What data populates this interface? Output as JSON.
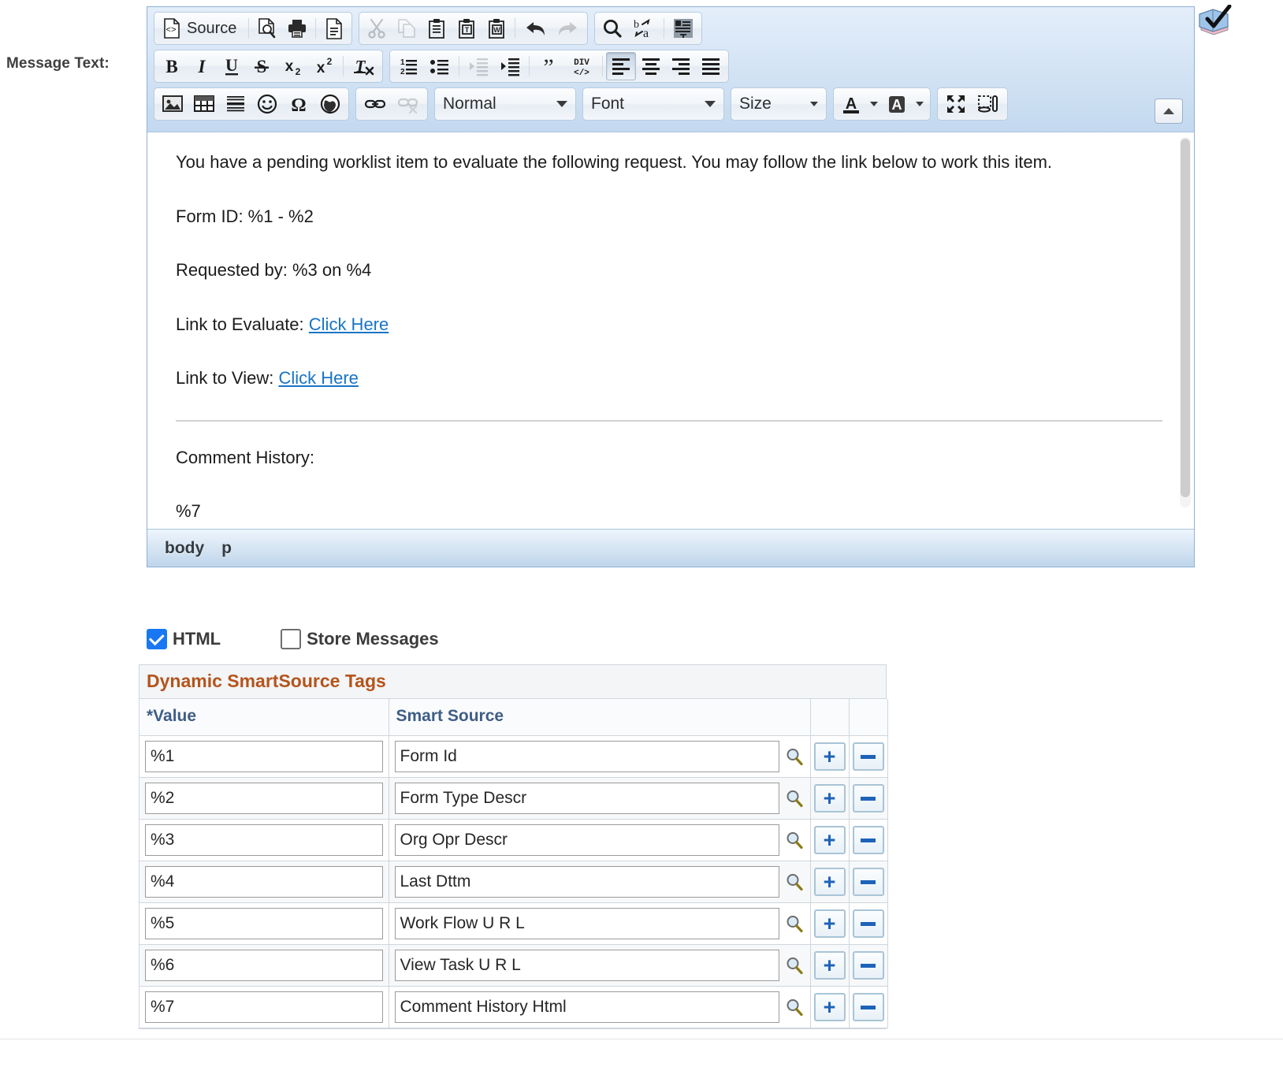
{
  "field_label": "Message Text:",
  "editor": {
    "toolbar": {
      "row1": [
        {
          "name": "source-button",
          "icon": "source-icon",
          "label": "Source",
          "type": "button"
        },
        {
          "name": "preview-button",
          "icon": "preview-icon",
          "type": "button"
        },
        {
          "name": "print-button",
          "icon": "print-icon",
          "type": "button"
        },
        {
          "name": "templates-button",
          "icon": "templates-icon",
          "type": "button"
        },
        {
          "name": "cut-button",
          "icon": "scissors-icon",
          "type": "button",
          "disabled": true
        },
        {
          "name": "copy-button",
          "icon": "copy-icon",
          "type": "button",
          "disabled": true
        },
        {
          "name": "paste-button",
          "icon": "paste-icon",
          "type": "button"
        },
        {
          "name": "paste-text-button",
          "icon": "paste-text-icon",
          "type": "button"
        },
        {
          "name": "paste-word-button",
          "icon": "paste-word-icon",
          "type": "button"
        },
        {
          "name": "undo-button",
          "icon": "undo-arrow-icon",
          "type": "button"
        },
        {
          "name": "redo-button",
          "icon": "redo-arrow-icon",
          "type": "button",
          "disabled": true
        },
        {
          "name": "find-button",
          "icon": "magnifier-icon",
          "type": "button"
        },
        {
          "name": "replace-button",
          "icon": "find-replace-icon",
          "type": "button"
        },
        {
          "name": "select-all-button",
          "icon": "select-all-icon",
          "type": "button"
        }
      ],
      "row2": [
        {
          "name": "bold-button",
          "icon": "bold-icon",
          "glyph": "B"
        },
        {
          "name": "italic-button",
          "icon": "italic-icon",
          "glyph": "I"
        },
        {
          "name": "underline-button",
          "icon": "underline-icon",
          "glyph": "U"
        },
        {
          "name": "strikethrough-button",
          "icon": "strikethrough-icon",
          "glyph": "S"
        },
        {
          "name": "subscript-button",
          "icon": "subscript-icon",
          "glyph": "x2"
        },
        {
          "name": "superscript-button",
          "icon": "superscript-icon",
          "glyph": "x2"
        },
        {
          "name": "remove-format-button",
          "icon": "remove-format-icon",
          "glyph": "Tx"
        },
        {
          "name": "numbered-list-button",
          "icon": "numbered-list-icon"
        },
        {
          "name": "bulleted-list-button",
          "icon": "bulleted-list-icon"
        },
        {
          "name": "outdent-button",
          "icon": "outdent-icon",
          "disabled": true
        },
        {
          "name": "indent-button",
          "icon": "indent-icon"
        },
        {
          "name": "blockquote-button",
          "icon": "blockquote-icon"
        },
        {
          "name": "create-div-button",
          "icon": "div-container-icon",
          "glyph": "DIV"
        },
        {
          "name": "align-left-button",
          "icon": "align-left-icon",
          "active": true
        },
        {
          "name": "align-center-button",
          "icon": "align-center-icon"
        },
        {
          "name": "align-right-button",
          "icon": "align-right-icon"
        },
        {
          "name": "align-justify-button",
          "icon": "align-justify-icon"
        }
      ],
      "row3": [
        {
          "name": "image-button",
          "icon": "image-icon"
        },
        {
          "name": "table-button",
          "icon": "table-icon"
        },
        {
          "name": "horizontal-rule-button",
          "icon": "horizontal-rule-icon"
        },
        {
          "name": "smiley-button",
          "icon": "smiley-icon"
        },
        {
          "name": "special-char-button",
          "icon": "omega-icon"
        },
        {
          "name": "iframe-button",
          "icon": "globe-icon"
        },
        {
          "name": "link-button",
          "icon": "link-icon"
        },
        {
          "name": "unlink-button",
          "icon": "unlink-icon",
          "disabled": true
        },
        {
          "name": "maximize-button",
          "icon": "maximize-icon"
        },
        {
          "name": "show-blocks-button",
          "icon": "show-blocks-icon"
        }
      ],
      "combos": {
        "paragraph_format": "Normal",
        "font_family": "Font",
        "font_size": "Size"
      },
      "text_color_label": "A",
      "bg_color_label": "A",
      "collapse_toolbar": "collapse-toolbar-button"
    },
    "body": {
      "p1": "You have a pending worklist item to evaluate the following request. You may follow the link below to work this item.",
      "p2": "Form ID: %1 - %2",
      "p3": "Requested by: %3 on %4",
      "p4_prefix": "Link to Evaluate: ",
      "p4_link": "Click Here",
      "p5_prefix": "Link to View: ",
      "p5_link": "Click Here",
      "p6": "Comment History:",
      "p7": "%7"
    },
    "element_path": [
      "body",
      "p"
    ]
  },
  "options": {
    "html": {
      "label": "HTML",
      "checked": true
    },
    "store_messages": {
      "label": "Store Messages",
      "checked": false
    }
  },
  "grid": {
    "title": "Dynamic SmartSource Tags",
    "columns": [
      "*Value",
      "Smart Source",
      "",
      ""
    ],
    "rows": [
      {
        "value": "%1",
        "smart_source": "Form Id"
      },
      {
        "value": "%2",
        "smart_source": "Form Type Descr"
      },
      {
        "value": "%3",
        "smart_source": "Org Opr Descr"
      },
      {
        "value": "%4",
        "smart_source": "Last Dttm"
      },
      {
        "value": "%5",
        "smart_source": "Work Flow U R L"
      },
      {
        "value": "%6",
        "smart_source": "View Task U R L"
      },
      {
        "value": "%7",
        "smart_source": "Comment History Html"
      }
    ],
    "row_add_button": "+",
    "row_delete_button": "-",
    "lookup_icon": "magnifier-lookup-icon"
  },
  "colors": {
    "accent_blue": "#1874c6",
    "grid_title": "#b5541b",
    "column_header": "#3f5d86",
    "checkbox_on": "#1877f2",
    "toolbar_top": "#e4eefa",
    "toolbar_bottom": "#c3d9ef"
  }
}
